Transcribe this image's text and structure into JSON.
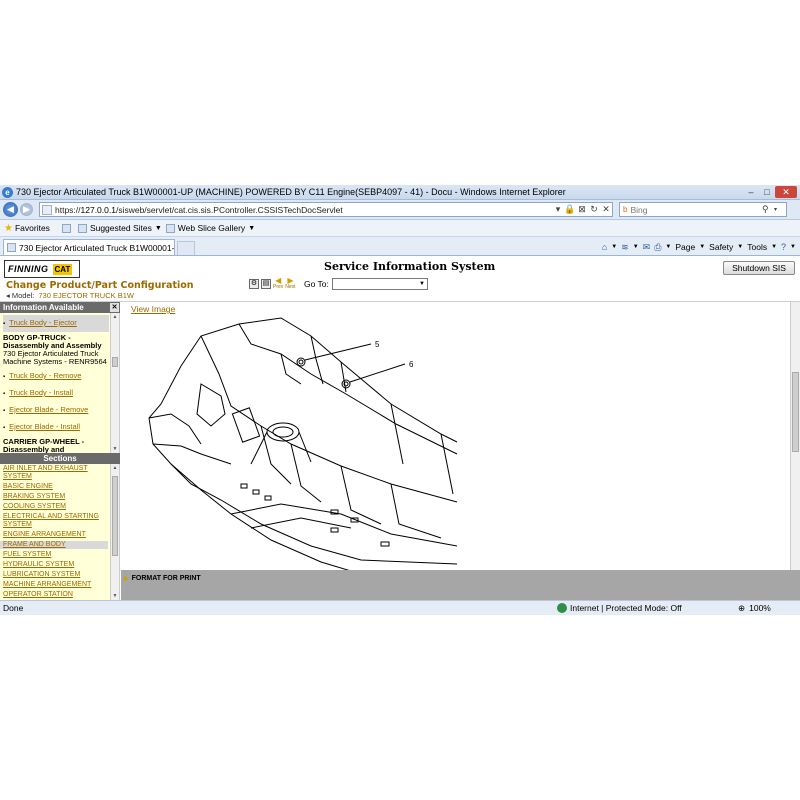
{
  "window": {
    "title": "730 Ejector Articulated Truck B1W00001-UP (MACHINE) POWERED BY C11 Engine(SEBP4097 - 41) - Docu - Windows Internet Explorer"
  },
  "address": {
    "url_prefix": "https://",
    "url_host": "127.0.0.1",
    "url_path": "/sisweb/servlet/cat.cis.sis.PController.CSSISTechDocServlet",
    "search_placeholder": "Bing"
  },
  "favorites": {
    "favorites_label": "Favorites",
    "suggested_sites": "Suggested Sites",
    "web_slice_gallery": "Web Slice Gallery"
  },
  "tabs": [
    {
      "label": "730 Ejector Articulated Truck B1W00001-UP (MA..."
    }
  ],
  "command_bar": {
    "page": "Page",
    "safety": "Safety",
    "tools": "Tools"
  },
  "sis": {
    "logo_text": "FINNING",
    "logo_badge": "CAT",
    "title": "Service Information System",
    "shutdown_label": "Shutdown SIS",
    "change_config": "Change Product/Part Configuration",
    "model_label": "Model:",
    "model_value": "730 EJECTOR TRUCK B1W",
    "goto_label": "Go To:",
    "prev_label": "Prev",
    "next_label": "Next"
  },
  "info_panel": {
    "title": "Information Available",
    "close": "✕",
    "items": [
      {
        "type": "link",
        "text": "Truck Body - Ejector",
        "selected": true
      },
      {
        "type": "head",
        "text": "BODY GP-TRUCK - Disassembly and Assembly"
      },
      {
        "type": "sub",
        "text": "730 Ejector Articulated Truck Machine Systems - RENR9564"
      },
      {
        "type": "link",
        "text": "Truck Body - Remove"
      },
      {
        "type": "link",
        "text": "Truck Body - Install"
      },
      {
        "type": "link",
        "text": "Ejector Blade - Remove"
      },
      {
        "type": "link",
        "text": "Ejector Blade - Install"
      },
      {
        "type": "head",
        "text": "CARRIER GP-WHEEL - Disassembly and"
      }
    ]
  },
  "sections_panel": {
    "title": "Sections",
    "items": [
      "AIR INLET AND EXHAUST SYSTEM",
      "BASIC ENGINE",
      "BRAKING SYSTEM",
      "COOLING SYSTEM",
      "ELECTRICAL AND STARTING SYSTEM",
      "ENGINE ARRANGEMENT",
      "FRAME AND BODY",
      "FUEL SYSTEM",
      "HYDRAULIC SYSTEM",
      "LUBRICATION SYSTEM",
      "MACHINE ARRANGEMENT",
      "OPERATOR STATION"
    ],
    "selected": "FRAME AND BODY"
  },
  "content": {
    "view_image": "View Image",
    "callouts": [
      "5",
      "6"
    ]
  },
  "format_print": "FORMAT FOR PRINT",
  "status": {
    "text": "Done",
    "zone": "Internet | Protected Mode: Off",
    "zoom": "100%"
  }
}
